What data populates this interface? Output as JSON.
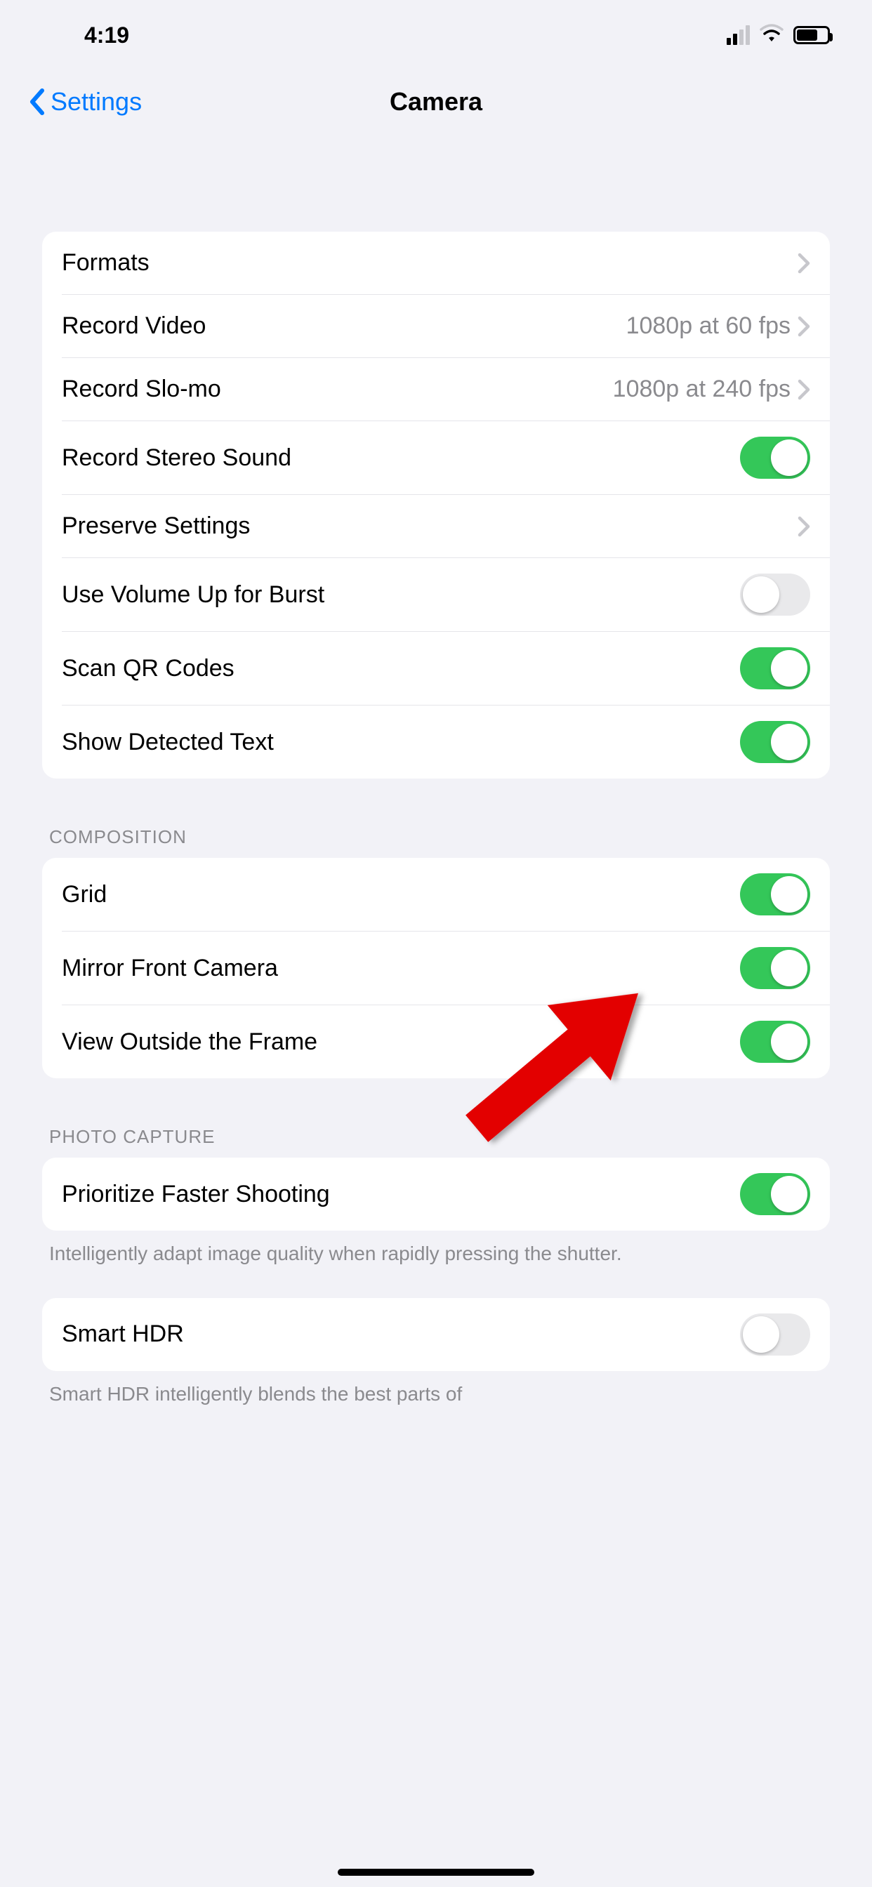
{
  "statusbar": {
    "time": "4:19"
  },
  "nav": {
    "back_label": "Settings",
    "title": "Camera"
  },
  "group1": {
    "rows": {
      "formats": {
        "label": "Formats"
      },
      "record_video": {
        "label": "Record Video",
        "detail": "1080p at 60 fps"
      },
      "record_slomo": {
        "label": "Record Slo-mo",
        "detail": "1080p at 240 fps"
      },
      "stereo": {
        "label": "Record Stereo Sound",
        "on": true
      },
      "preserve": {
        "label": "Preserve Settings"
      },
      "volume_burst": {
        "label": "Use Volume Up for Burst",
        "on": false
      },
      "scan_qr": {
        "label": "Scan QR Codes",
        "on": true
      },
      "detected_text": {
        "label": "Show Detected Text",
        "on": true
      }
    }
  },
  "composition": {
    "header": "COMPOSITION",
    "rows": {
      "grid": {
        "label": "Grid",
        "on": true
      },
      "mirror": {
        "label": "Mirror Front Camera",
        "on": true
      },
      "view_outside": {
        "label": "View Outside the Frame",
        "on": true
      }
    }
  },
  "photo_capture": {
    "header": "PHOTO CAPTURE",
    "rows": {
      "faster_shooting": {
        "label": "Prioritize Faster Shooting",
        "on": true
      },
      "smart_hdr": {
        "label": "Smart HDR",
        "on": false
      }
    },
    "footers": {
      "faster_shooting": "Intelligently adapt image quality when rapidly pressing the shutter.",
      "smart_hdr": "Smart HDR intelligently blends the best parts of"
    }
  },
  "colors": {
    "accent": "#007aff",
    "toggle_on": "#34c759",
    "toggle_off": "#e9e9eb",
    "bg": "#f2f2f7",
    "separator": "#e5e5ea",
    "secondary_text": "#8a8a8e",
    "annotation_arrow": "#e30000"
  }
}
